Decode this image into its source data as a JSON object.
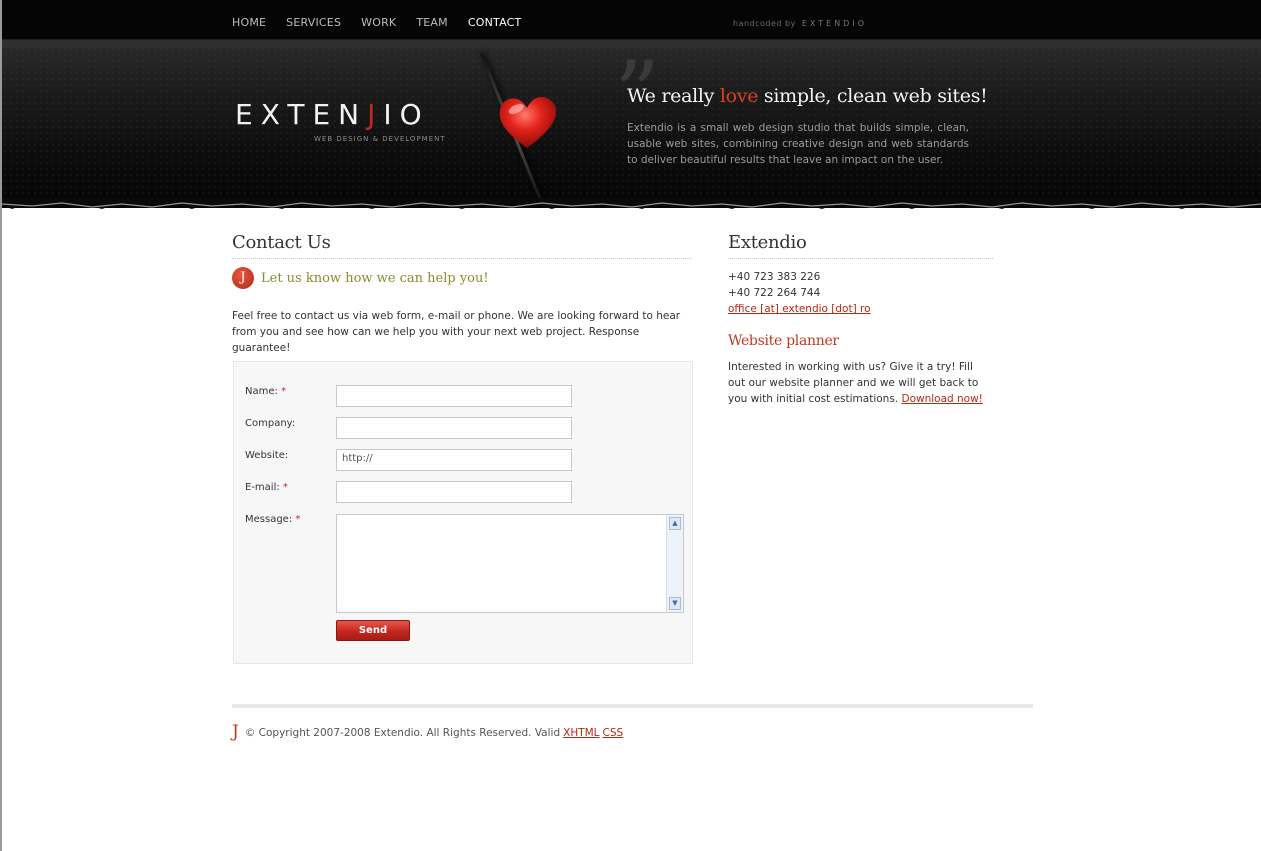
{
  "nav": {
    "items": [
      "HOME",
      "SERVICES",
      "WORK",
      "TEAM",
      "CONTACT"
    ],
    "active": "CONTACT"
  },
  "handcoded": {
    "label": "handcoded by",
    "brand": "EXTENDIO"
  },
  "header": {
    "logo_pre": "EXTEN",
    "logo_j": "J",
    "logo_post": "IO",
    "tagline": "WEB DESIGN & DEVELOPMENT",
    "headline_pre": "We really",
    "headline_love": "love",
    "headline_post": "simple, clean web sites!",
    "intro": "Extendio is a small web design studio that builds simple, clean, usable web sites, combining creative design and web standards to deliver beautiful results that leave an impact on the user."
  },
  "contact": {
    "title": "Contact Us",
    "bullet": "J",
    "subtitle": "Let us know how we can help you!",
    "intro": "Feel free to contact us via web form, e-mail or phone. We are looking forward to hear from you and see how can we help you with your next web project. Response guarantee!",
    "form": {
      "name_label": "Name:",
      "company_label": "Company:",
      "website_label": "Website:",
      "website_value": "http://",
      "email_label": "E-mail:",
      "message_label": "Message:",
      "required_mark": "*",
      "send_label": "Send"
    }
  },
  "sidebar": {
    "title": "Extendio",
    "phone1": "+40 723 383 226",
    "phone2": "+40 722 264 744",
    "email": "office [at] extendio [dot] ro",
    "planner_title": "Website planner",
    "planner_text": "Interested in working with us? Give it a try! Fill out our website planner and we will get back to you with initial cost estimations.",
    "planner_link": "Download now!"
  },
  "footer": {
    "mark": "J",
    "copyright": "© Copyright 2007-2008 Extendio. All Rights Reserved. Valid",
    "xhtml": "XHTML",
    "css": "CSS"
  },
  "colors": {
    "accent": "#c0281f",
    "header_bg": "#0c0c0c",
    "subtitle": "#8a8d2c"
  }
}
